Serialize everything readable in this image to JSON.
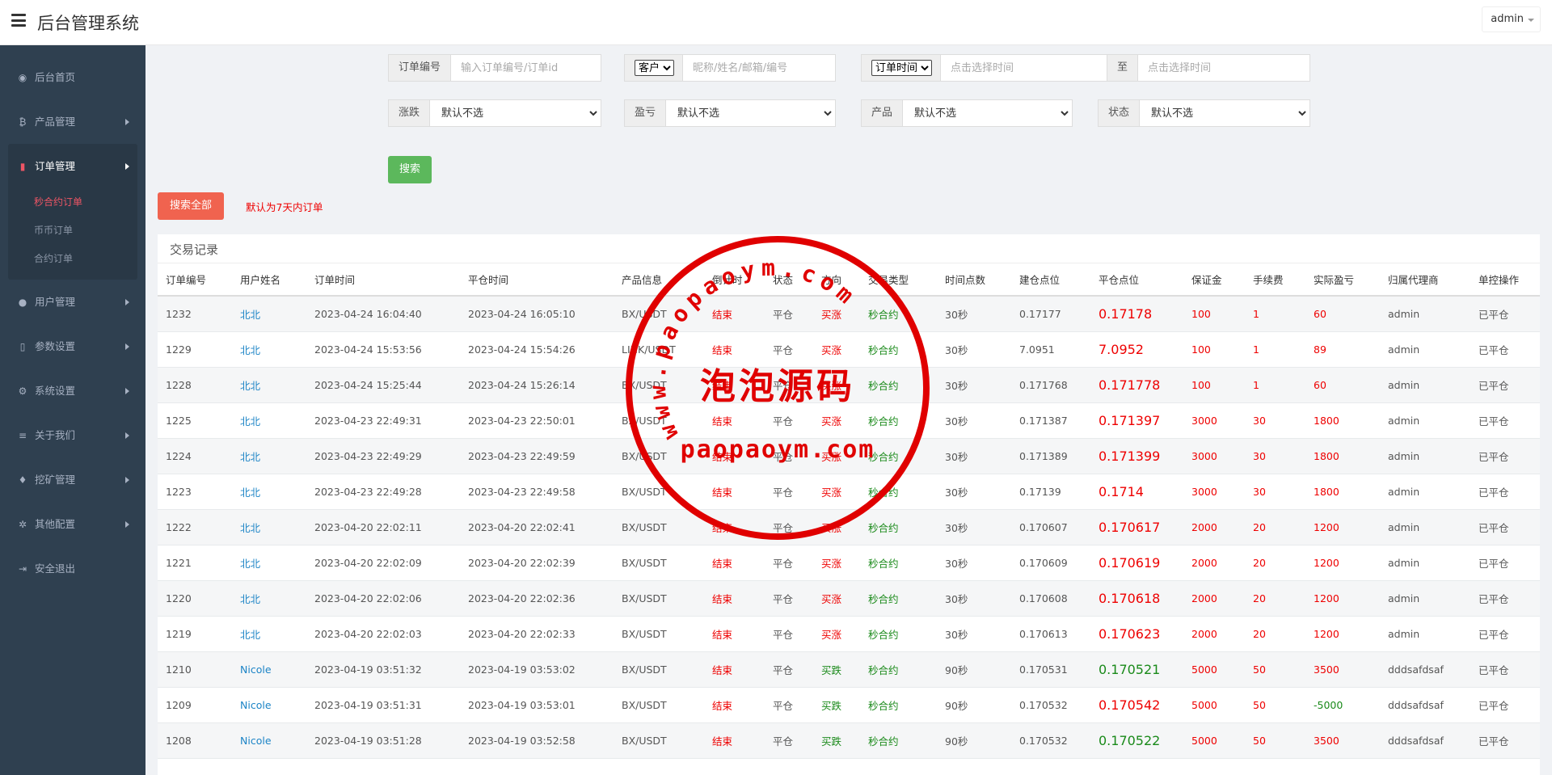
{
  "header": {
    "title": "后台管理系统",
    "user": "admin"
  },
  "sidebar": {
    "items": [
      {
        "label": "后台首页",
        "icon": "dashboard-icon",
        "glyph": "◉",
        "arrow": false
      },
      {
        "label": "产品管理",
        "icon": "bitcoin-icon",
        "glyph": "₿",
        "arrow": true
      },
      {
        "label": "订单管理",
        "icon": "copy-icon",
        "glyph": "▮",
        "arrow": true
      },
      {
        "label": "用户管理",
        "icon": "user-icon",
        "glyph": "●",
        "arrow": true
      },
      {
        "label": "参数设置",
        "icon": "file-icon",
        "glyph": "▯",
        "arrow": true
      },
      {
        "label": "系统设置",
        "icon": "gears-icon",
        "glyph": "⚙",
        "arrow": true
      },
      {
        "label": "关于我们",
        "icon": "list-icon",
        "glyph": "≡",
        "arrow": true
      },
      {
        "label": "挖矿管理",
        "icon": "bell-icon",
        "glyph": "♦",
        "arrow": true
      },
      {
        "label": "其他配置",
        "icon": "cog-icon",
        "glyph": "✲",
        "arrow": true
      },
      {
        "label": "安全退出",
        "icon": "sign-out-icon",
        "glyph": "⇥",
        "arrow": false
      }
    ],
    "order_sub": [
      "秒合约订单",
      "币币订单",
      "合约订单"
    ]
  },
  "filters": {
    "order_no_label": "订单编号",
    "order_no_placeholder": "输入订单编号/订单id",
    "customer_select": "客户",
    "customer_placeholder": "昵称/姓名/邮箱/编号",
    "time_select": "订单时间",
    "time_start_placeholder": "点击选择时间",
    "to_label": "至",
    "time_end_placeholder": "点击选择时间",
    "rise_fall_label": "涨跌",
    "profit_label": "盈亏",
    "product_label": "产品",
    "status_label": "状态",
    "default_option": "默认不选"
  },
  "buttons": {
    "search": "搜索",
    "search_all": "搜索全部",
    "hint": "默认为7天内订单"
  },
  "table": {
    "title": "交易记录",
    "columns": [
      "订单编号",
      "用户姓名",
      "订单时间",
      "平仓时间",
      "产品信息",
      "倒计时",
      "状态",
      "方向",
      "交易类型",
      "时间点数",
      "建仓点位",
      "平仓点位",
      "保证金",
      "手续费",
      "实际盈亏",
      "归属代理商",
      "单控操作"
    ],
    "rows": [
      [
        "1232",
        "北北",
        "2023-04-24 16:04:40",
        "2023-04-24 16:05:10",
        "BX/USDT",
        "结束",
        "平仓",
        "买涨",
        "秒合约",
        "30秒",
        "0.17177",
        "0.17178",
        "100",
        "1",
        "60",
        "admin",
        "已平仓"
      ],
      [
        "1229",
        "北北",
        "2023-04-24 15:53:56",
        "2023-04-24 15:54:26",
        "LINK/USDT",
        "结束",
        "平仓",
        "买涨",
        "秒合约",
        "30秒",
        "7.0951",
        "7.0952",
        "100",
        "1",
        "89",
        "admin",
        "已平仓"
      ],
      [
        "1228",
        "北北",
        "2023-04-24 15:25:44",
        "2023-04-24 15:26:14",
        "BX/USDT",
        "结束",
        "平仓",
        "买涨",
        "秒合约",
        "30秒",
        "0.171768",
        "0.171778",
        "100",
        "1",
        "60",
        "admin",
        "已平仓"
      ],
      [
        "1225",
        "北北",
        "2023-04-23 22:49:31",
        "2023-04-23 22:50:01",
        "BX/USDT",
        "结束",
        "平仓",
        "买涨",
        "秒合约",
        "30秒",
        "0.171387",
        "0.171397",
        "3000",
        "30",
        "1800",
        "admin",
        "已平仓"
      ],
      [
        "1224",
        "北北",
        "2023-04-23 22:49:29",
        "2023-04-23 22:49:59",
        "BX/USDT",
        "结束",
        "平仓",
        "买涨",
        "秒合约",
        "30秒",
        "0.171389",
        "0.171399",
        "3000",
        "30",
        "1800",
        "admin",
        "已平仓"
      ],
      [
        "1223",
        "北北",
        "2023-04-23 22:49:28",
        "2023-04-23 22:49:58",
        "BX/USDT",
        "结束",
        "平仓",
        "买涨",
        "秒合约",
        "30秒",
        "0.17139",
        "0.1714",
        "3000",
        "30",
        "1800",
        "admin",
        "已平仓"
      ],
      [
        "1222",
        "北北",
        "2023-04-20 22:02:11",
        "2023-04-20 22:02:41",
        "BX/USDT",
        "结束",
        "平仓",
        "买涨",
        "秒合约",
        "30秒",
        "0.170607",
        "0.170617",
        "2000",
        "20",
        "1200",
        "admin",
        "已平仓"
      ],
      [
        "1221",
        "北北",
        "2023-04-20 22:02:09",
        "2023-04-20 22:02:39",
        "BX/USDT",
        "结束",
        "平仓",
        "买涨",
        "秒合约",
        "30秒",
        "0.170609",
        "0.170619",
        "2000",
        "20",
        "1200",
        "admin",
        "已平仓"
      ],
      [
        "1220",
        "北北",
        "2023-04-20 22:02:06",
        "2023-04-20 22:02:36",
        "BX/USDT",
        "结束",
        "平仓",
        "买涨",
        "秒合约",
        "30秒",
        "0.170608",
        "0.170618",
        "2000",
        "20",
        "1200",
        "admin",
        "已平仓"
      ],
      [
        "1219",
        "北北",
        "2023-04-20 22:02:03",
        "2023-04-20 22:02:33",
        "BX/USDT",
        "结束",
        "平仓",
        "买涨",
        "秒合约",
        "30秒",
        "0.170613",
        "0.170623",
        "2000",
        "20",
        "1200",
        "admin",
        "已平仓"
      ],
      [
        "1210",
        "Nicole",
        "2023-04-19 03:51:32",
        "2023-04-19 03:53:02",
        "BX/USDT",
        "结束",
        "平仓",
        "买跌",
        "秒合约",
        "90秒",
        "0.170531",
        "0.170521",
        "5000",
        "50",
        "3500",
        "dddsafdsaf",
        "已平仓"
      ],
      [
        "1209",
        "Nicole",
        "2023-04-19 03:51:31",
        "2023-04-19 03:53:01",
        "BX/USDT",
        "结束",
        "平仓",
        "买跌",
        "秒合约",
        "90秒",
        "0.170532",
        "0.170542",
        "5000",
        "50",
        "-5000",
        "dddsafdsaf",
        "已平仓"
      ],
      [
        "1208",
        "Nicole",
        "2023-04-19 03:51:28",
        "2023-04-19 03:52:58",
        "BX/USDT",
        "结束",
        "平仓",
        "买跌",
        "秒合约",
        "90秒",
        "0.170532",
        "0.170522",
        "5000",
        "50",
        "3500",
        "dddsafdsaf",
        "已平仓"
      ]
    ]
  },
  "watermark": {
    "top_text": "www.paopaoym.com",
    "middle_text": "泡泡源码",
    "bottom_text": "paopaoym.com",
    "color": "#e00000"
  }
}
